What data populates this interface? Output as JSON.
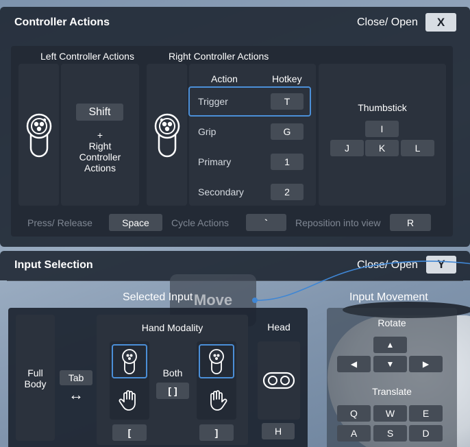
{
  "controller_actions": {
    "title": "Controller Actions",
    "close_open_label": "Close/ Open",
    "close_open_key": "X",
    "left_header": "Left Controller Actions",
    "right_header": "Right Controller Actions",
    "shift_key": "Shift",
    "plus_text": "+",
    "right_ctrl_text_1": "Right",
    "right_ctrl_text_2": "Controller",
    "right_ctrl_text_3": "Actions",
    "table": {
      "action_header": "Action",
      "hotkey_header": "Hotkey",
      "rows": [
        {
          "action": "Trigger",
          "hotkey": "T"
        },
        {
          "action": "Grip",
          "hotkey": "G"
        },
        {
          "action": "Primary",
          "hotkey": "1"
        },
        {
          "action": "Secondary",
          "hotkey": "2"
        }
      ]
    },
    "thumbstick": {
      "title": "Thumbstick",
      "keys": {
        "up": "I",
        "left": "J",
        "down": "K",
        "right": "L"
      }
    },
    "footer": {
      "press_release_label": "Press/ Release",
      "press_release_key": "Space",
      "cycle_label": "Cycle Actions",
      "cycle_key": "`",
      "reposition_label": "Reposition into view",
      "reposition_key": "R"
    }
  },
  "input_selection": {
    "title": "Input Selection",
    "close_open_label": "Close/ Open",
    "close_open_key": "Y",
    "selected_input_label": "Selected Input",
    "full_body_1": "Full",
    "full_body_2": "Body",
    "tab_key": "Tab",
    "swap_symbol": "↔",
    "hand_modality_label": "Hand Modality",
    "both_label": "Both",
    "both_key": "[ ]",
    "left_key": "[",
    "right_key": "]",
    "head_label": "Head",
    "head_key": "H"
  },
  "input_movement": {
    "title": "Input Movement",
    "rotate_label": "Rotate",
    "rotate_keys": {
      "up": "▲",
      "left": "◀",
      "down": "▼",
      "right": "▶"
    },
    "translate_label": "Translate",
    "translate_keys": [
      "Q",
      "W",
      "E",
      "A",
      "S",
      "D"
    ]
  },
  "background": {
    "move_label": "Move"
  },
  "colors": {
    "panel": "#1c2430",
    "key": "#454c56",
    "selection": "#4b8fd8",
    "muted_text": "#7f8793"
  }
}
